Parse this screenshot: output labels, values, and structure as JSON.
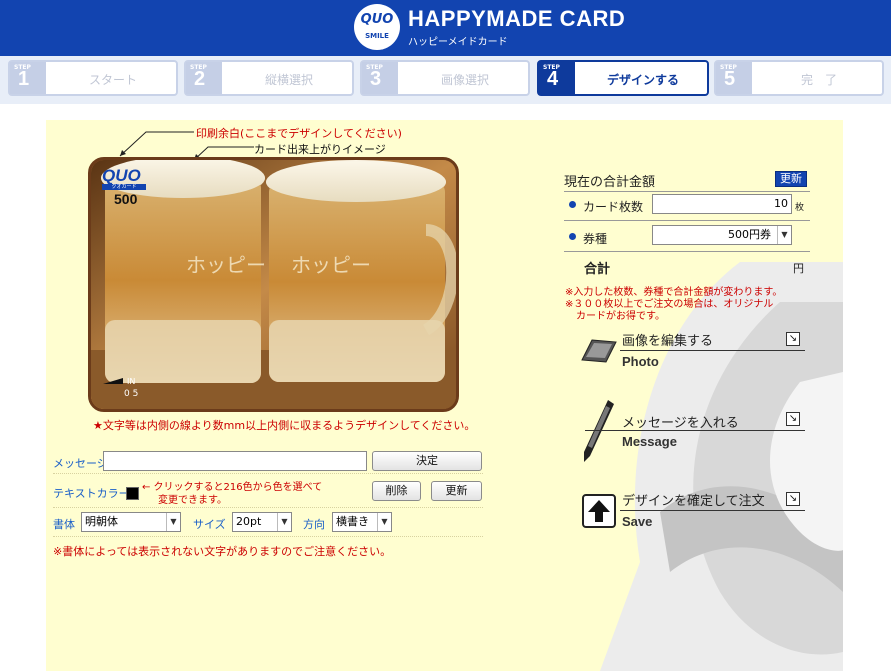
{
  "header": {
    "logo_top": "QUO",
    "logo_bottom": "SMILE",
    "title": "HAPPYMADE CARD",
    "subtitle": "ハッピーメイドカード"
  },
  "steps": [
    {
      "label": "STEP",
      "num": "1",
      "name": "スタート",
      "active": false
    },
    {
      "label": "STEP",
      "num": "2",
      "name": "縦横選択",
      "active": false
    },
    {
      "label": "STEP",
      "num": "3",
      "name": "画像選択",
      "active": false
    },
    {
      "label": "STEP",
      "num": "4",
      "name": "デザインする",
      "active": true
    },
    {
      "label": "STEP",
      "num": "5",
      "name": "完　了",
      "active": false
    }
  ],
  "preview": {
    "annotation_margin": "印刷余白(ここまでデザインしてください)",
    "annotation_finish": "カード出来上がりイメージ",
    "quo_logo": "QUO",
    "quo_sub": "クオカード",
    "quo_value": "500",
    "in_label": "IN",
    "in_num": "0 5",
    "warning": "★文字等は内側の線より数mm以上内側に収まるようデザインしてください。"
  },
  "form": {
    "message_label": "メッセージ",
    "message_value": "",
    "decide_button": "決定",
    "text_color_label": "テキストカラー",
    "color_hint_line1": "← クリックすると216色から色を選べて",
    "color_hint_line2": "変更できます。",
    "delete_button": "削除",
    "update_button": "更新",
    "font_label": "書体",
    "font_value": "明朝体",
    "size_label": "サイズ",
    "size_value": "20pt",
    "direction_label": "方向",
    "direction_value": "横書き",
    "font_note": "※書体によっては表示されない文字がありますのでご注意ください。"
  },
  "summary": {
    "title": "現在の合計金額",
    "refresh_button": "更新",
    "count_label": "カード枚数",
    "count_value": "10",
    "count_unit": "枚",
    "type_label": "券種",
    "type_value": "500円券",
    "total_label": "合計",
    "total_unit": "円",
    "note_line1": "※入力した枚数、券種で合計金額が変わります。",
    "note_line2": "※３００枚以上でご注文の場合は、オリジナル",
    "note_line3": "カードがお得です。"
  },
  "actions": {
    "edit_label": "画像を編集する",
    "edit_sub": "Photo",
    "message_label": "メッセージを入れる",
    "message_sub": "Message",
    "save_label": "デザインを確定して注文",
    "save_sub": "Save"
  },
  "colors": {
    "header_blue": "#1244b0",
    "panel_yellow": "#fffed0",
    "accent_red": "#cc0000",
    "label_blue": "#1a5fc8"
  }
}
